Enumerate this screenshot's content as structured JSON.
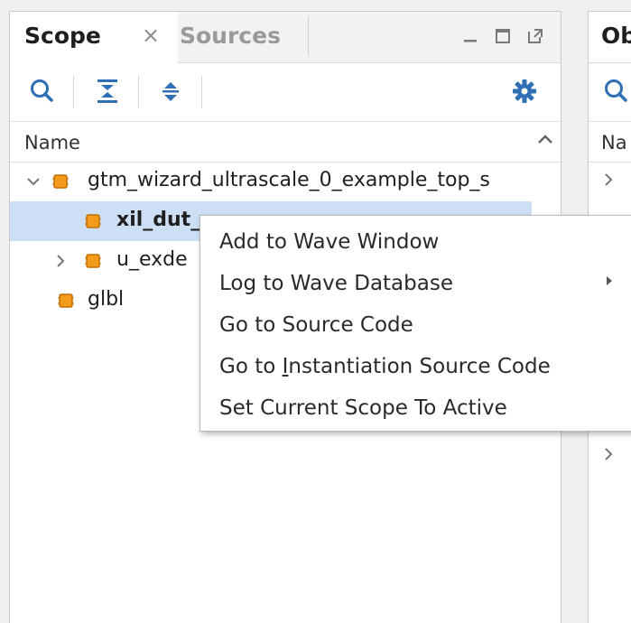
{
  "left_panel": {
    "tabs": [
      {
        "label": "Scope",
        "active": true,
        "close": "×"
      },
      {
        "label": "Sources",
        "active": false
      }
    ],
    "window_controls": [
      "minimize-icon",
      "restore-icon",
      "float-icon"
    ],
    "toolbar_icons": [
      "search-icon",
      "collapse-all-icon",
      "expand-all-icon",
      "gear-icon"
    ],
    "column_header": "Name",
    "tree": [
      {
        "label": "gtm_wizard_ultrascale_0_example_top_s",
        "expanded": true,
        "selected": false
      },
      {
        "label": "xil_dut_",
        "bold": true,
        "selected": true
      },
      {
        "label": "u_exde",
        "expanded": false,
        "selected": false
      },
      {
        "label": "glbl",
        "selected": false
      }
    ]
  },
  "right_panel": {
    "tab_label": "Ob",
    "toolbar_icon": "search-icon",
    "column_header": "Na"
  },
  "context_menu": {
    "items": [
      {
        "label": "Add to Wave Window"
      },
      {
        "label": "Log to Wave Database",
        "submenu": true
      },
      {
        "label": "Go to Source Code"
      },
      {
        "label_before": "Go to ",
        "mnemonic": "I",
        "label_after": "nstantiation Source Code"
      },
      {
        "label": "Set Current Scope To Active"
      }
    ]
  },
  "colors": {
    "accent": "#2f6fb3",
    "selection": "#cddff5",
    "chip_orange": "#f39c1c",
    "chip_border": "#c26e00"
  }
}
